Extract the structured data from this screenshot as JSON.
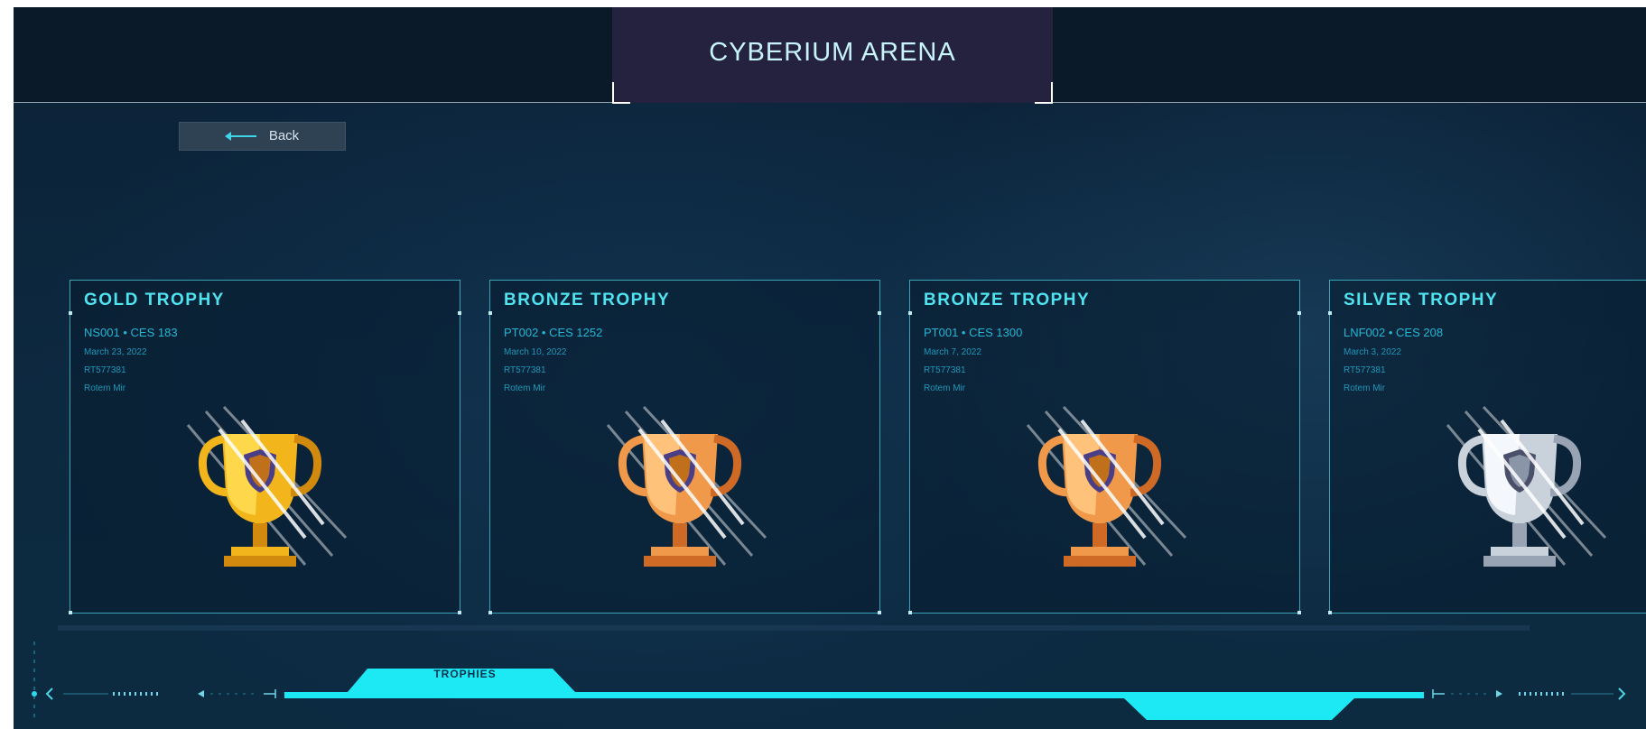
{
  "app": {
    "title": "CYBERIUM ARENA"
  },
  "back_button": {
    "label": "Back"
  },
  "cards": [
    {
      "title": "GOLD TROPHY",
      "code": "NS001 • CES 183",
      "date": "March 23, 2022",
      "id": "RT577381",
      "name": "Rotem Mir",
      "tier": "gold"
    },
    {
      "title": "BRONZE TROPHY",
      "code": "PT002 • CES 1252",
      "date": "March 10, 2022",
      "id": "RT577381",
      "name": "Rotem Mir",
      "tier": "bronze"
    },
    {
      "title": "BRONZE TROPHY",
      "code": "PT001 • CES 1300",
      "date": "March 7, 2022",
      "id": "RT577381",
      "name": "Rotem Mir",
      "tier": "bronze"
    },
    {
      "title": "SILVER TROPHY",
      "code": "LNF002 • CES 208",
      "date": "March 3, 2022",
      "id": "RT577381",
      "name": "Rotem Mir",
      "tier": "silver"
    }
  ],
  "nav": {
    "active_tab": "TROPHIES"
  },
  "colors": {
    "accent": "#1de9f5",
    "gold": [
      "#ffd74a",
      "#f2b51b",
      "#d18a0d"
    ],
    "bronze": [
      "#ffc27a",
      "#f0994a",
      "#cf6a26"
    ],
    "silver": [
      "#f4f7fb",
      "#c9d1db",
      "#98a4b3"
    ],
    "shield": "#4a3f86"
  },
  "icons": [
    "left-arrow-icon",
    "trophy-icon",
    "shield-icon",
    "chevron-left-icon",
    "chevron-right-icon"
  ]
}
